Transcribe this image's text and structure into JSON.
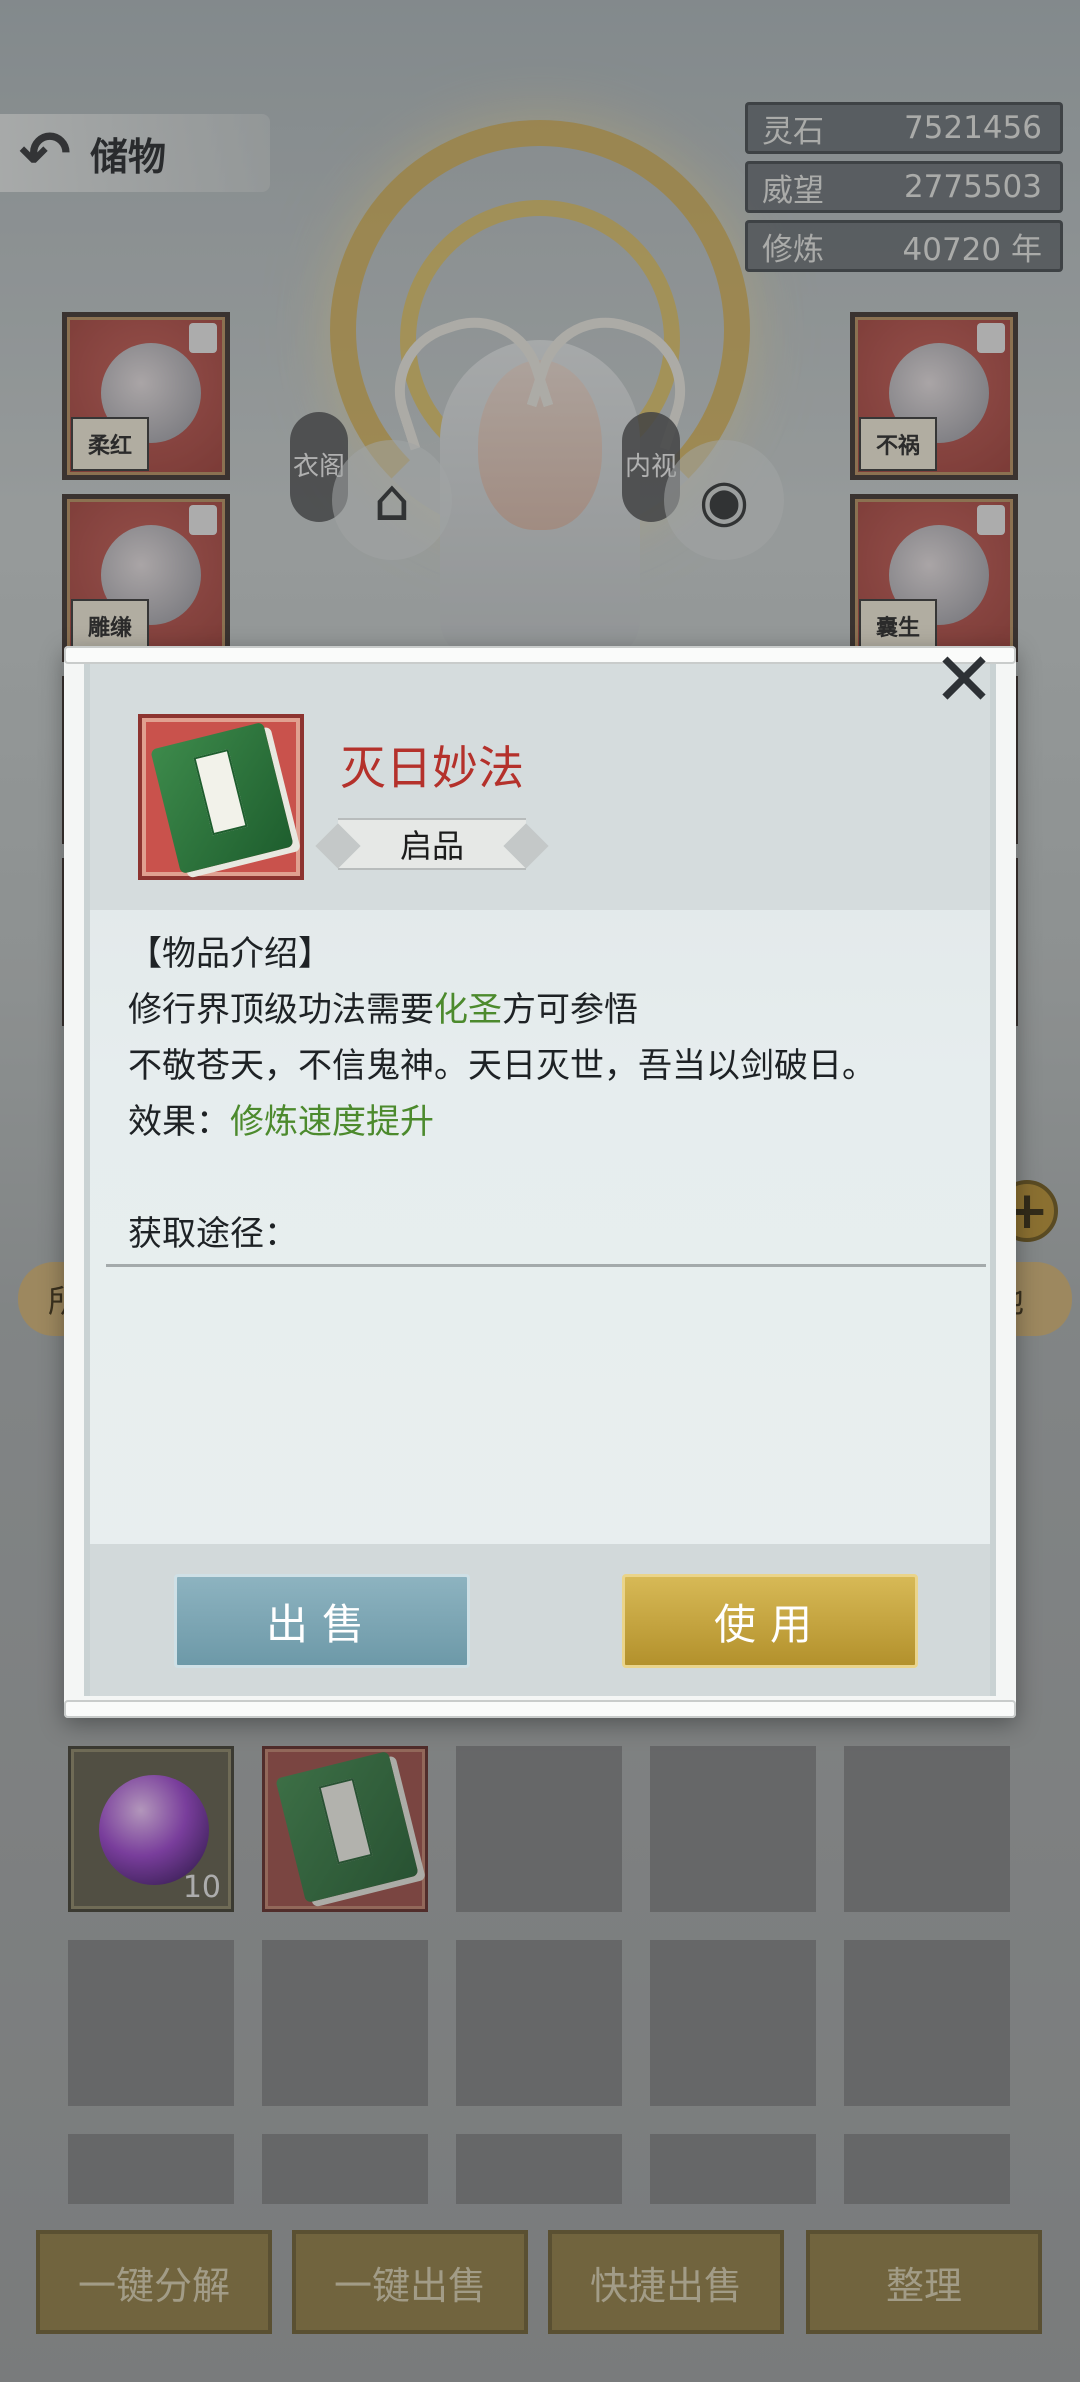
{
  "header": {
    "title": "储物"
  },
  "stats": [
    {
      "label": "灵石",
      "value": "7521456"
    },
    {
      "label": "威望",
      "value": "2775503"
    },
    {
      "label": "修炼",
      "value": "40720 年"
    }
  ],
  "character": {
    "left_tag": "衣阁",
    "right_tag": "内视"
  },
  "equipment_seals": {
    "left_top": "柔红",
    "left_mid": "雕缣",
    "right_top": "不祸",
    "right_mid": "囊生"
  },
  "tabs": {
    "left_partial": "所",
    "right_partial": "他"
  },
  "modal": {
    "item_name": "灭日妙法",
    "grade": "启品",
    "section_intro": "【物品介绍】",
    "desc_line1_prefix": "修行界顶级功法需要",
    "desc_line1_highlight": "化圣",
    "desc_line1_suffix": "方可参悟",
    "desc_line2": "不敬苍天，不信鬼神。天日灭世，吾当以剑破日。",
    "effect_label": "效果：",
    "effect_value": "修炼速度提升",
    "source_label": "获取途径：",
    "sell_button": "出售",
    "use_button": "使用",
    "close_icon": "close-x-icon"
  },
  "inventory": {
    "orb_quantity": "10"
  },
  "actions": {
    "decompose_all": "一键分解",
    "sell_all": "一键出售",
    "quick_sell": "快捷出售",
    "organize": "整理"
  },
  "colors": {
    "item_name": "#b4312b",
    "highlight_green": "#4c8a2d",
    "sell_button": "#7aa5b4",
    "use_button": "#c7a640",
    "action_button": "#8e7a3f"
  }
}
